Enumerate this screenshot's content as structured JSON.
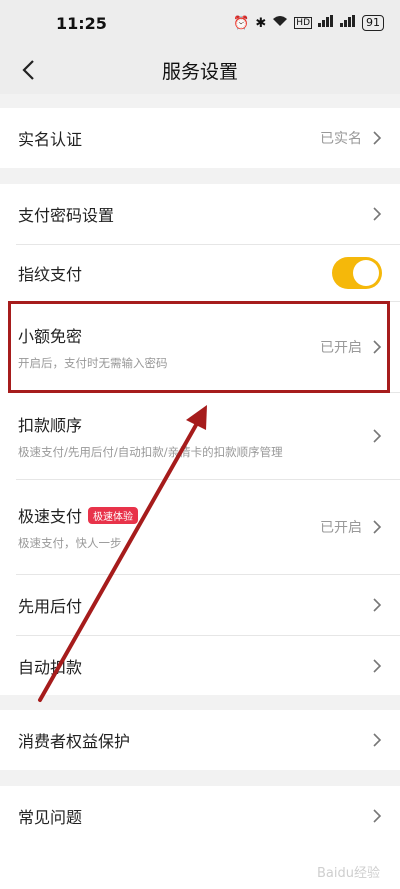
{
  "status_bar": {
    "time": "11:25",
    "icons": [
      "alarm-icon",
      "bluetooth-icon",
      "wifi-icon",
      "hd-icon",
      "signal-icon",
      "signal-icon"
    ],
    "hd_label": "HD",
    "battery": "91"
  },
  "nav": {
    "title": "服务设置"
  },
  "rows": {
    "realname": {
      "label": "实名认证",
      "value": "已实名"
    },
    "paypwd": {
      "label": "支付密码设置"
    },
    "fingerprint": {
      "label": "指纹支付",
      "enabled": true
    },
    "smallpay": {
      "label": "小额免密",
      "sub": "开启后，支付时无需输入密码",
      "value": "已开启"
    },
    "order": {
      "label": "扣款顺序",
      "sub": "极速支付/先用后付/自动扣款/亲情卡的扣款顺序管理"
    },
    "fastpay": {
      "label": "极速支付",
      "badge": "极速体验",
      "sub": "极速支付，快人一步",
      "value": "已开启"
    },
    "paylater": {
      "label": "先用后付"
    },
    "autodebit": {
      "label": "自动扣款"
    },
    "consumer": {
      "label": "消费者权益保护"
    },
    "faq": {
      "label": "常见问题"
    }
  },
  "colors": {
    "toggle": "#f5b80a",
    "highlight": "#a61c1c",
    "badge": "#e8334a"
  },
  "watermark": "Baidu经验"
}
